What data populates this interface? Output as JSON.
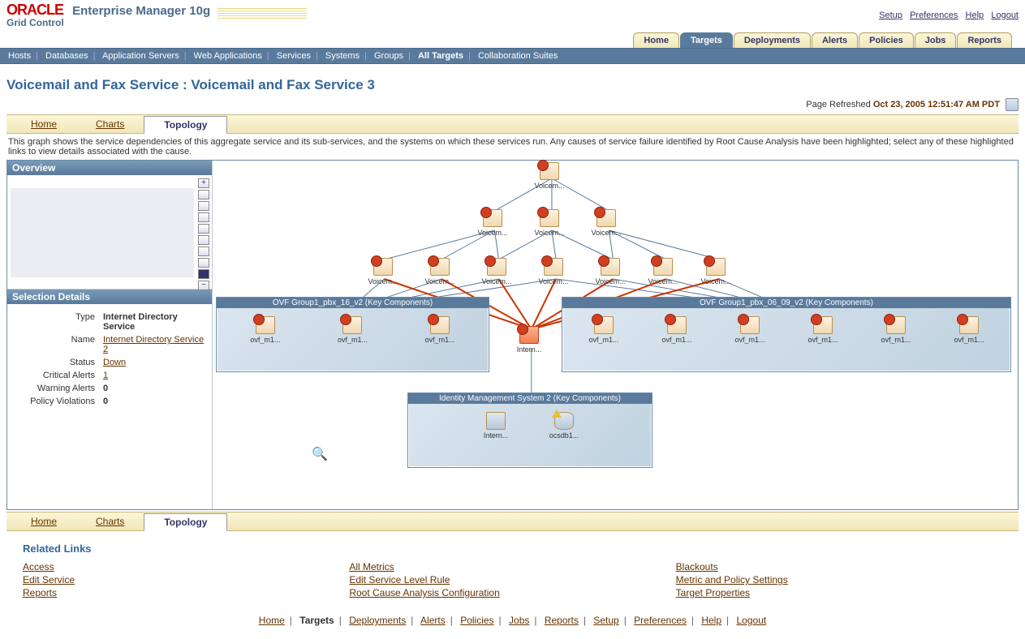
{
  "header": {
    "logo_oracle": "ORACLE",
    "logo_em": "Enterprise Manager 10g",
    "logo_sub": "Grid Control",
    "links": [
      "Setup",
      "Preferences",
      "Help",
      "Logout"
    ]
  },
  "main_tabs": [
    "Home",
    "Targets",
    "Deployments",
    "Alerts",
    "Policies",
    "Jobs",
    "Reports"
  ],
  "main_tab_selected": 1,
  "sub_tabs": [
    "Hosts",
    "Databases",
    "Application Servers",
    "Web Applications",
    "Services",
    "Systems",
    "Groups",
    "All Targets",
    "Collaboration Suites"
  ],
  "sub_tab_selected": 7,
  "page_title": "Voicemail and Fax Service : Voicemail and Fax Service 3",
  "refresh": {
    "label": "Page Refreshed",
    "timestamp": "Oct 23, 2005 12:51:47 AM PDT"
  },
  "view_tabs": [
    "Home",
    "Charts",
    "Topology"
  ],
  "view_tab_selected": 2,
  "description": "This graph shows the service dependencies of this aggregate service and its sub-services, and the systems on which these services run. Any causes of service failure identified by Root Cause Analysis have been highlighted; select any of these highlighted links to view details associated with the cause.",
  "overview_title": "Overview",
  "selection_title": "Selection Details",
  "selection": {
    "type_label": "Type",
    "type_value": "Internet Directory Service",
    "name_label": "Name",
    "name_value": "Internet Directory Service 2",
    "status_label": "Status",
    "status_value": "Down",
    "crit_label": "Critical Alerts",
    "crit_value": "1",
    "warn_label": "Warning Alerts",
    "warn_value": "0",
    "pol_label": "Policy Violations",
    "pol_value": "0"
  },
  "nodes": {
    "top": "Voicem...",
    "r2a": "Voicem...",
    "r2b": "Voicem...",
    "r2c": "Voicem...",
    "r3a": "Voicem...",
    "r3b": "Voicem...",
    "r3c": "Voicem...",
    "r3d": "Voicem...",
    "r3e": "Voicem...",
    "r3f": "Voicem...",
    "r3g": "Voicem...",
    "center": "Intern...",
    "g1_title": "OVF Group1_pbx_16_v2 (Key Components)",
    "g2_title": "OVF Group1_pbx_06_09_v2 (Key Components)",
    "g3_title": "Identity Management System 2 (Key Components)",
    "ovf": "ovf_m1...",
    "im1": "Intern...",
    "im2": "ocsdb1..."
  },
  "related_title": "Related Links",
  "related": {
    "col1": [
      "Access",
      "Edit Service",
      "Reports"
    ],
    "col2": [
      "All Metrics",
      "Edit Service Level Rule",
      "Root Cause Analysis Configuration"
    ],
    "col3": [
      "Blackouts",
      "Metric and Policy Settings",
      "Target Properties"
    ]
  },
  "footer_nav": [
    "Home",
    "Targets",
    "Deployments",
    "Alerts",
    "Policies",
    "Jobs",
    "Reports",
    "Setup",
    "Preferences",
    "Help",
    "Logout"
  ],
  "footer_selected": 1
}
